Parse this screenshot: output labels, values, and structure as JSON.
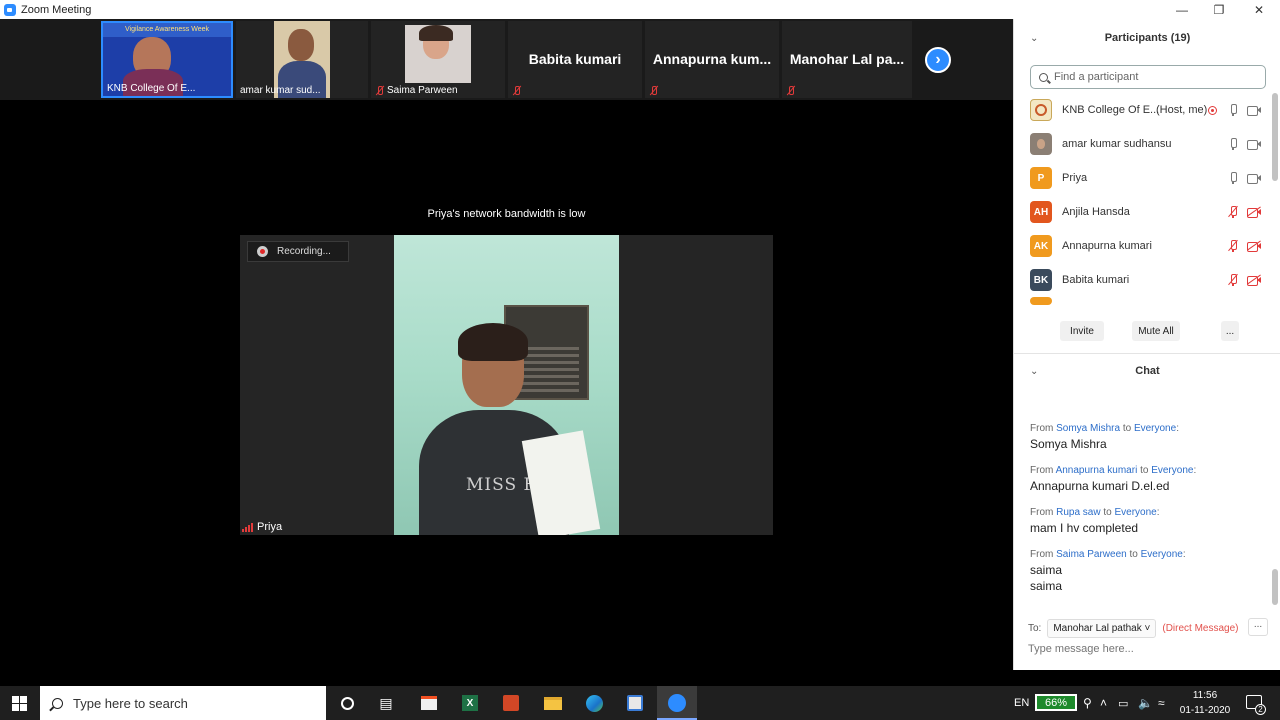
{
  "window": {
    "title": "Zoom Meeting"
  },
  "thumbnails": [
    {
      "name": "KNB College Of E...",
      "banner": "Vigilance Awareness Week",
      "muted": false
    },
    {
      "name": "amar kumar sud...",
      "muted": false
    },
    {
      "name": "Saima Parween",
      "muted": true
    },
    {
      "name": "Babita kumari",
      "muted": true
    },
    {
      "name": "Annapurna kum...",
      "muted": true
    },
    {
      "name": "Manohar Lal pa...",
      "muted": true
    }
  ],
  "main": {
    "bandwidth_notice": "Priya's network bandwidth is low",
    "recording_label": "Recording...",
    "speaker_name": "Priya",
    "shirt_text": "MISS FANC"
  },
  "participants": {
    "title": "Participants (19)",
    "search_placeholder": "Find a participant",
    "items": [
      {
        "name": "KNB College Of E...",
        "tag": "(Host, me)",
        "initials": "",
        "color": "#e8d7a8",
        "mic_off": false,
        "cam_off": false
      },
      {
        "name": "amar kumar sudhansu",
        "tag": "",
        "initials": "",
        "color": "#8b7f74",
        "mic_off": false,
        "cam_off": false
      },
      {
        "name": "Priya",
        "tag": "",
        "initials": "P",
        "color": "#f09a1e",
        "mic_off": false,
        "cam_off": false
      },
      {
        "name": "Anjila  Hansda",
        "tag": "",
        "initials": "AH",
        "color": "#e2561e",
        "mic_off": true,
        "cam_off": true
      },
      {
        "name": "Annapurna kumari",
        "tag": "",
        "initials": "AK",
        "color": "#f09a1e",
        "mic_off": true,
        "cam_off": true
      },
      {
        "name": "Babita kumari",
        "tag": "",
        "initials": "BK",
        "color": "#3a4a5c",
        "mic_off": true,
        "cam_off": true
      }
    ],
    "buttons": {
      "invite": "Invite",
      "mute_all": "Mute All",
      "more": "..."
    }
  },
  "chat": {
    "title": "Chat",
    "messages": [
      {
        "from": "Somya Mishra",
        "to": "Everyone",
        "text": "Somya Mishra"
      },
      {
        "from": "Annapurna kumari",
        "to": "Everyone",
        "text": "Annapurna kumari D.el.ed"
      },
      {
        "from": "Rupa saw",
        "to": "Everyone",
        "text": "mam  I hv completed"
      },
      {
        "from": "Saima Parween",
        "to": "Everyone",
        "text": "saima\nsaima"
      }
    ],
    "from_word": "From",
    "to_word": "to",
    "to_label": "To:",
    "recipient": "Manohar Lal pathak",
    "direct_label": "(Direct Message)",
    "more": "...",
    "input_placeholder": "Type message here..."
  },
  "taskbar": {
    "search_placeholder": "Type here to search",
    "language": "EN",
    "battery": "66%",
    "time": "11:56",
    "date": "01-11-2020",
    "notifications": "2"
  },
  "colors": {
    "zoom_blue": "#2d8cff",
    "muted_red": "#e23a3a",
    "link_blue": "#2d6ec9"
  }
}
